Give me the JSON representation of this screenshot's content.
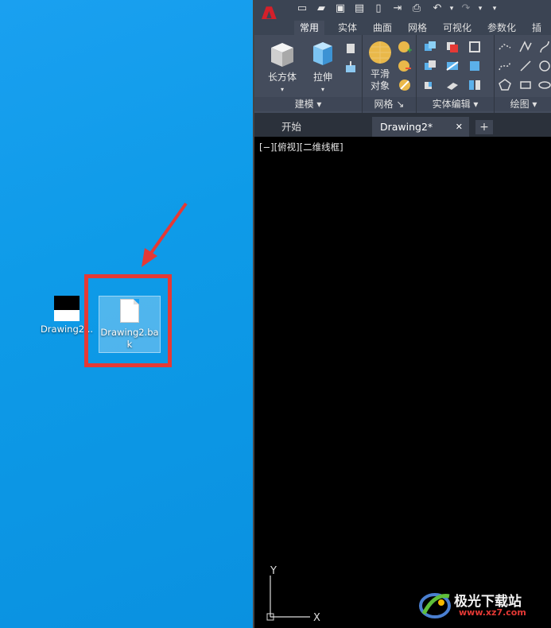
{
  "desktop": {
    "icons": [
      {
        "label": "Drawing2...",
        "type": "dwg"
      },
      {
        "label": "Drawing2.bak",
        "type": "file"
      }
    ]
  },
  "cad": {
    "logo_letter": "A",
    "ribbon_tabs": [
      "常用",
      "实体",
      "曲面",
      "网格",
      "可视化",
      "参数化",
      "插入"
    ],
    "active_tab": "常用",
    "panels": {
      "modeling": {
        "title": "建模",
        "box_label": "长方体",
        "extrude_label": "拉伸"
      },
      "mesh": {
        "title": "网格",
        "smooth_label_1": "平滑",
        "smooth_label_2": "对象"
      },
      "solid_edit": {
        "title": "实体编辑"
      },
      "draw": {
        "title": "绘图"
      }
    },
    "doc_tabs": {
      "start": "开始",
      "drawing": "Drawing2*",
      "close": "✕",
      "add": "+"
    },
    "viewport_label": "[−][俯视][二维线框]",
    "ucs": {
      "x": "X",
      "y": "Y"
    }
  },
  "watermark": {
    "title": "极光下载站",
    "url": "www.xz7.com"
  },
  "colors": {
    "desktop": "#1aa0f0",
    "highlight": "#e53935",
    "ribbon": "#444c5c",
    "qat": "#3b4453",
    "logo": "#d4202a"
  }
}
